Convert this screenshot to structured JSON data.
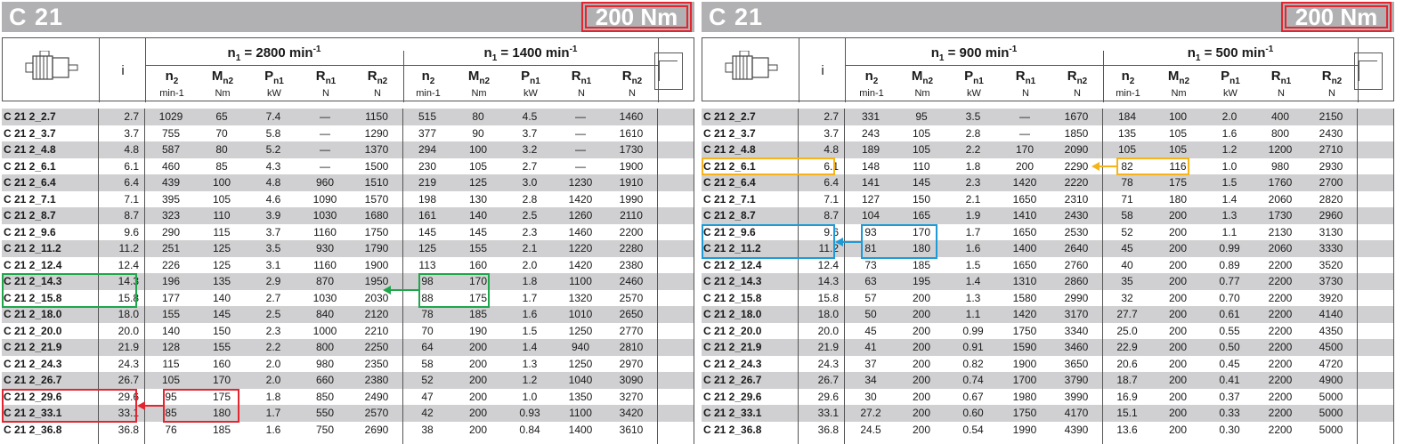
{
  "left": {
    "title": "C 21",
    "torque": "200 Nm",
    "speed_a": "2800",
    "speed_b": "1400",
    "rows": [
      [
        "C 21 2_2.7",
        "2.7",
        "1029",
        "65",
        "7.4",
        "—",
        "1150",
        "515",
        "80",
        "4.5",
        "—",
        "1460"
      ],
      [
        "C 21 2_3.7",
        "3.7",
        "755",
        "70",
        "5.8",
        "—",
        "1290",
        "377",
        "90",
        "3.7",
        "—",
        "1610"
      ],
      [
        "C 21 2_4.8",
        "4.8",
        "587",
        "80",
        "5.2",
        "—",
        "1370",
        "294",
        "100",
        "3.2",
        "—",
        "1730"
      ],
      [
        "C 21 2_6.1",
        "6.1",
        "460",
        "85",
        "4.3",
        "—",
        "1500",
        "230",
        "105",
        "2.7",
        "—",
        "1900"
      ],
      [
        "C 21 2_6.4",
        "6.4",
        "439",
        "100",
        "4.8",
        "960",
        "1510",
        "219",
        "125",
        "3.0",
        "1230",
        "1910"
      ],
      [
        "C 21 2_7.1",
        "7.1",
        "395",
        "105",
        "4.6",
        "1090",
        "1570",
        "198",
        "130",
        "2.8",
        "1420",
        "1990"
      ],
      [
        "C 21 2_8.7",
        "8.7",
        "323",
        "110",
        "3.9",
        "1030",
        "1680",
        "161",
        "140",
        "2.5",
        "1260",
        "2110"
      ],
      [
        "C 21 2_9.6",
        "9.6",
        "290",
        "115",
        "3.7",
        "1160",
        "1750",
        "145",
        "145",
        "2.3",
        "1460",
        "2200"
      ],
      [
        "C 21 2_11.2",
        "11.2",
        "251",
        "125",
        "3.5",
        "930",
        "1790",
        "125",
        "155",
        "2.1",
        "1220",
        "2280"
      ],
      [
        "C 21 2_12.4",
        "12.4",
        "226",
        "125",
        "3.1",
        "1160",
        "1900",
        "113",
        "160",
        "2.0",
        "1420",
        "2380"
      ],
      [
        "C 21 2_14.3",
        "14.3",
        "196",
        "135",
        "2.9",
        "870",
        "1950",
        "98",
        "170",
        "1.8",
        "1100",
        "2460"
      ],
      [
        "C 21 2_15.8",
        "15.8",
        "177",
        "140",
        "2.7",
        "1030",
        "2030",
        "88",
        "175",
        "1.7",
        "1320",
        "2570"
      ],
      [
        "C 21 2_18.0",
        "18.0",
        "155",
        "145",
        "2.5",
        "840",
        "2120",
        "78",
        "185",
        "1.6",
        "1010",
        "2650"
      ],
      [
        "C 21 2_20.0",
        "20.0",
        "140",
        "150",
        "2.3",
        "1000",
        "2210",
        "70",
        "190",
        "1.5",
        "1250",
        "2770"
      ],
      [
        "C 21 2_21.9",
        "21.9",
        "128",
        "155",
        "2.2",
        "800",
        "2250",
        "64",
        "200",
        "1.4",
        "940",
        "2810"
      ],
      [
        "C 21 2_24.3",
        "24.3",
        "115",
        "160",
        "2.0",
        "980",
        "2350",
        "58",
        "200",
        "1.3",
        "1250",
        "2970"
      ],
      [
        "C 21 2_26.7",
        "26.7",
        "105",
        "170",
        "2.0",
        "660",
        "2380",
        "52",
        "200",
        "1.2",
        "1040",
        "3090"
      ],
      [
        "C 21 2_29.6",
        "29.6",
        "95",
        "175",
        "1.8",
        "850",
        "2490",
        "47",
        "200",
        "1.0",
        "1350",
        "3270"
      ],
      [
        "C 21 2_33.1",
        "33.1",
        "85",
        "180",
        "1.7",
        "550",
        "2570",
        "42",
        "200",
        "0.93",
        "1100",
        "3420"
      ],
      [
        "C 21 2_36.8",
        "36.8",
        "76",
        "185",
        "1.6",
        "750",
        "2690",
        "38",
        "200",
        "0.84",
        "1400",
        "3610"
      ]
    ]
  },
  "right": {
    "title": "C 21",
    "torque": "200 Nm",
    "speed_a": "900",
    "speed_b": "500",
    "rows": [
      [
        "C 21 2_2.7",
        "2.7",
        "331",
        "95",
        "3.5",
        "—",
        "1670",
        "184",
        "100",
        "2.0",
        "400",
        "2150"
      ],
      [
        "C 21 2_3.7",
        "3.7",
        "243",
        "105",
        "2.8",
        "—",
        "1850",
        "135",
        "105",
        "1.6",
        "800",
        "2430"
      ],
      [
        "C 21 2_4.8",
        "4.8",
        "189",
        "105",
        "2.2",
        "170",
        "2090",
        "105",
        "105",
        "1.2",
        "1200",
        "2710"
      ],
      [
        "C 21 2_6.1",
        "6.1",
        "148",
        "110",
        "1.8",
        "200",
        "2290",
        "82",
        "116",
        "1.0",
        "980",
        "2930"
      ],
      [
        "C 21 2_6.4",
        "6.4",
        "141",
        "145",
        "2.3",
        "1420",
        "2220",
        "78",
        "175",
        "1.5",
        "1760",
        "2700"
      ],
      [
        "C 21 2_7.1",
        "7.1",
        "127",
        "150",
        "2.1",
        "1650",
        "2310",
        "71",
        "180",
        "1.4",
        "2060",
        "2820"
      ],
      [
        "C 21 2_8.7",
        "8.7",
        "104",
        "165",
        "1.9",
        "1410",
        "2430",
        "58",
        "200",
        "1.3",
        "1730",
        "2960"
      ],
      [
        "C 21 2_9.6",
        "9.6",
        "93",
        "170",
        "1.7",
        "1650",
        "2530",
        "52",
        "200",
        "1.1",
        "2130",
        "3130"
      ],
      [
        "C 21 2_11.2",
        "11.2",
        "81",
        "180",
        "1.6",
        "1400",
        "2640",
        "45",
        "200",
        "0.99",
        "2060",
        "3330"
      ],
      [
        "C 21 2_12.4",
        "12.4",
        "73",
        "185",
        "1.5",
        "1650",
        "2760",
        "40",
        "200",
        "0.89",
        "2200",
        "3520"
      ],
      [
        "C 21 2_14.3",
        "14.3",
        "63",
        "195",
        "1.4",
        "1310",
        "2860",
        "35",
        "200",
        "0.77",
        "2200",
        "3730"
      ],
      [
        "C 21 2_15.8",
        "15.8",
        "57",
        "200",
        "1.3",
        "1580",
        "2990",
        "32",
        "200",
        "0.70",
        "2200",
        "3920"
      ],
      [
        "C 21 2_18.0",
        "18.0",
        "50",
        "200",
        "1.1",
        "1420",
        "3170",
        "27.7",
        "200",
        "0.61",
        "2200",
        "4140"
      ],
      [
        "C 21 2_20.0",
        "20.0",
        "45",
        "200",
        "0.99",
        "1750",
        "3340",
        "25.0",
        "200",
        "0.55",
        "2200",
        "4350"
      ],
      [
        "C 21 2_21.9",
        "21.9",
        "41",
        "200",
        "0.91",
        "1590",
        "3460",
        "22.9",
        "200",
        "0.50",
        "2200",
        "4500"
      ],
      [
        "C 21 2_24.3",
        "24.3",
        "37",
        "200",
        "0.82",
        "1900",
        "3650",
        "20.6",
        "200",
        "0.45",
        "2200",
        "4720"
      ],
      [
        "C 21 2_26.7",
        "26.7",
        "34",
        "200",
        "0.74",
        "1700",
        "3790",
        "18.7",
        "200",
        "0.41",
        "2200",
        "4900"
      ],
      [
        "C 21 2_29.6",
        "29.6",
        "30",
        "200",
        "0.67",
        "1980",
        "3990",
        "16.9",
        "200",
        "0.37",
        "2200",
        "5000"
      ],
      [
        "C 21 2_33.1",
        "33.1",
        "27.2",
        "200",
        "0.60",
        "1750",
        "4170",
        "15.1",
        "200",
        "0.33",
        "2200",
        "5000"
      ],
      [
        "C 21 2_36.8",
        "36.8",
        "24.5",
        "200",
        "0.54",
        "1990",
        "4390",
        "13.6",
        "200",
        "0.30",
        "2200",
        "5000"
      ]
    ]
  },
  "header": {
    "i_label": "i",
    "n_base": "n",
    "n_sub": "1",
    "eq": " = ",
    "min_unit": " min",
    "min_exp": "-1",
    "cols": [
      {
        "base": "n",
        "sub": "2",
        "unit": "min-1"
      },
      {
        "base": "M",
        "sub": "n2",
        "unit": "Nm"
      },
      {
        "base": "P",
        "sub": "n1",
        "unit": "kW"
      },
      {
        "base": "R",
        "sub": "n1",
        "unit": "N"
      },
      {
        "base": "R",
        "sub": "n2",
        "unit": "N"
      }
    ]
  },
  "colors": {
    "shade": "#d0d0d2",
    "title_bar": "#b1b1b3",
    "green": "#1fa64a",
    "red": "#e3252f",
    "yellow": "#f4b41a",
    "blue": "#1e9ad6"
  }
}
